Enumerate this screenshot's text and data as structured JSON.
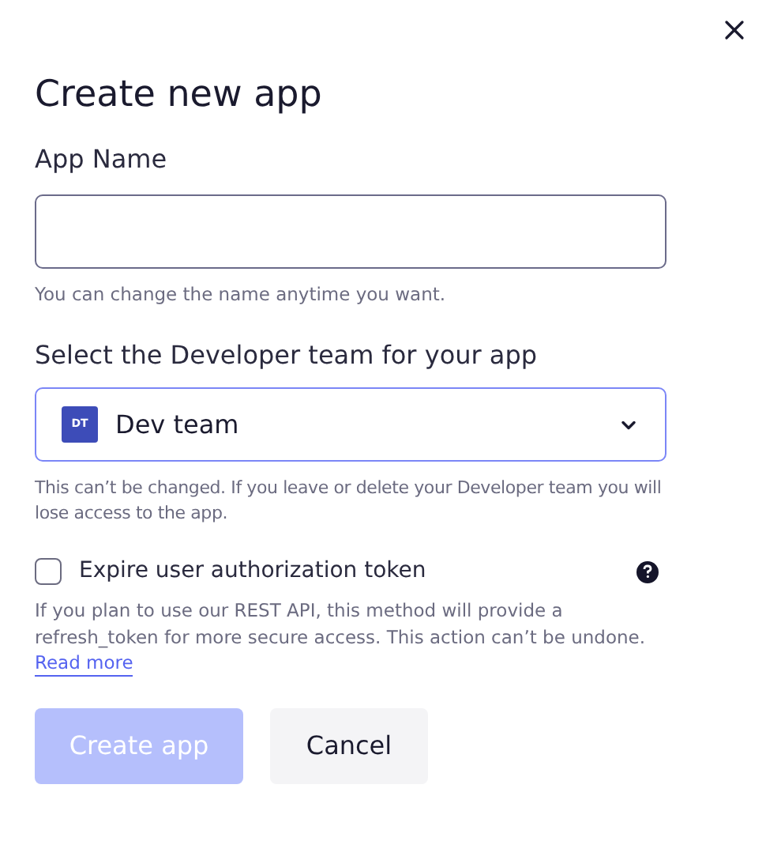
{
  "dialog": {
    "title": "Create new app"
  },
  "app_name": {
    "label": "App Name",
    "hint": "You can change the name anytime you want."
  },
  "team": {
    "label": "Select the Developer team for your app",
    "avatar": "DT",
    "value": "Dev team",
    "hint": "This can’t be changed. If you leave or delete your Developer team you will lose access to the app."
  },
  "expire_token": {
    "label": "Expire user authorization token",
    "checked": false,
    "help": "If you plan to use our REST API, this method will provide a refresh_token for more secure access. This action can’t be undone.",
    "link": "Read more"
  },
  "buttons": [
    {
      "label": "Create app",
      "kind": "primary",
      "disabled": true
    },
    {
      "label": "Cancel",
      "kind": "secondary",
      "disabled": false
    }
  ]
}
